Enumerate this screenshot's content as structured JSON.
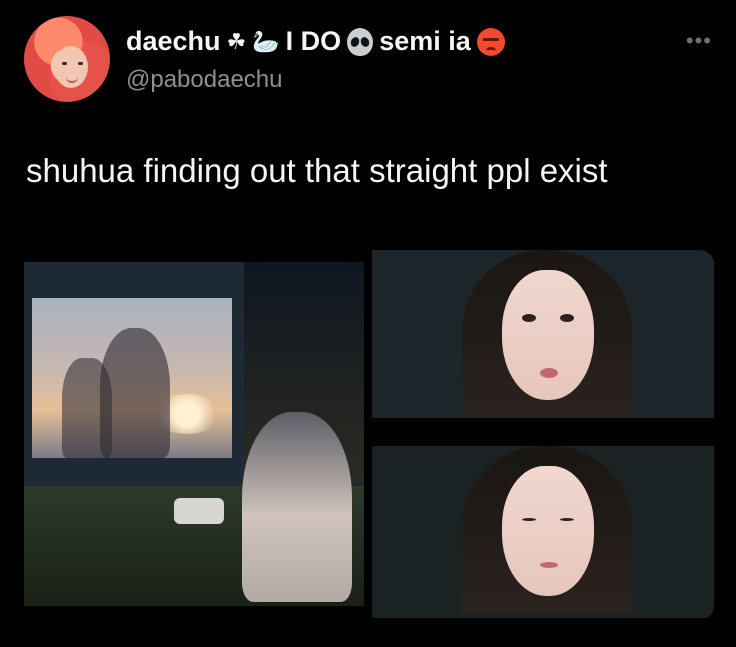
{
  "tweet": {
    "display_name": "daechu",
    "name_text_1": "I DO",
    "name_text_2": "semi ia",
    "icons": [
      "clover-icon",
      "swan-icon",
      "alien-icon",
      "angry-face-icon"
    ],
    "handle": "@pabodaechu",
    "text": "shuhua finding out that straight ppl exist",
    "more_label": "•••"
  },
  "media": {
    "images": [
      {
        "name": "outdoor-movie-image"
      },
      {
        "name": "shocked-face-image"
      },
      {
        "name": "crying-face-image"
      }
    ]
  }
}
